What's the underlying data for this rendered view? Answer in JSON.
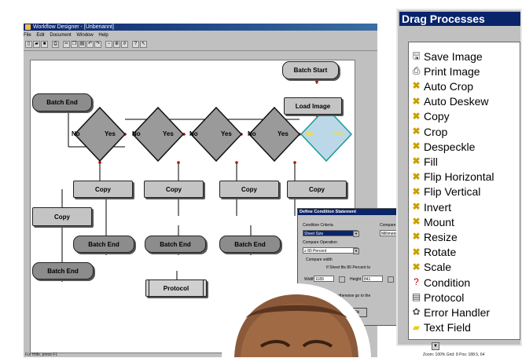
{
  "window": {
    "title": "Workflow Designer - [Unbenannt]",
    "menu": [
      "File",
      "Edit",
      "Document",
      "Window",
      "Help"
    ],
    "status_left": "Für Hilfe, press F1",
    "status_right": "Zoom: 100%  Grid: 8  Pos: 188.5, 64"
  },
  "flow": {
    "batch_start": "Batch Start",
    "load_image": "Load Image",
    "batch_end": "Batch End",
    "no": "No",
    "yes": "Yes",
    "copy": "Copy",
    "protocol": "Protocol"
  },
  "dialog": {
    "title": "Define Condition Statement",
    "criteria_label": "Condition Criteria",
    "criteria_value": "Sheet Size",
    "compare_label": "Compare",
    "compare_value": "Millimeter",
    "operation_label": "Compare Operation",
    "operation_value": "≥ 80 Percent",
    "compare_width": "Compare width",
    "if_text": "If Sheet fits 80 Percent to",
    "width_label": "Width",
    "width_value": "1189",
    "height_label": "Height",
    "height_value": "841",
    "path_text": "If YES path, otherwise go to the",
    "ok": "Ok"
  },
  "panel": {
    "title": "Drag Processes",
    "items": [
      {
        "label": "Save Image",
        "icon": "save-image-icon"
      },
      {
        "label": "Print Image",
        "icon": "print-image-icon"
      },
      {
        "label": "Auto Crop",
        "icon": "tool-icon"
      },
      {
        "label": "Auto Deskew",
        "icon": "tool-icon"
      },
      {
        "label": "Copy",
        "icon": "tool-icon"
      },
      {
        "label": "Crop",
        "icon": "tool-icon"
      },
      {
        "label": "Despeckle",
        "icon": "tool-icon"
      },
      {
        "label": "Fill",
        "icon": "tool-icon"
      },
      {
        "label": "Flip Horizontal",
        "icon": "tool-icon"
      },
      {
        "label": "Flip Vertical",
        "icon": "tool-icon"
      },
      {
        "label": "Invert",
        "icon": "tool-icon"
      },
      {
        "label": "Mount",
        "icon": "tool-icon"
      },
      {
        "label": "Resize",
        "icon": "tool-icon"
      },
      {
        "label": "Rotate",
        "icon": "tool-icon"
      },
      {
        "label": "Scale",
        "icon": "tool-icon"
      },
      {
        "label": "Condition",
        "icon": "condition-icon"
      },
      {
        "label": "Protocol",
        "icon": "protocol-icon"
      },
      {
        "label": "Error Handler",
        "icon": "error-handler-icon"
      },
      {
        "label": "Text Field",
        "icon": "text-field-icon"
      }
    ]
  },
  "colors": {
    "title_bar": "#0a246a",
    "selected_diamond_fill": "#bcd8e8",
    "selected_diamond_stroke": "#1a9a9a",
    "selected_label": "#f0e030",
    "connector": "#c00000"
  }
}
